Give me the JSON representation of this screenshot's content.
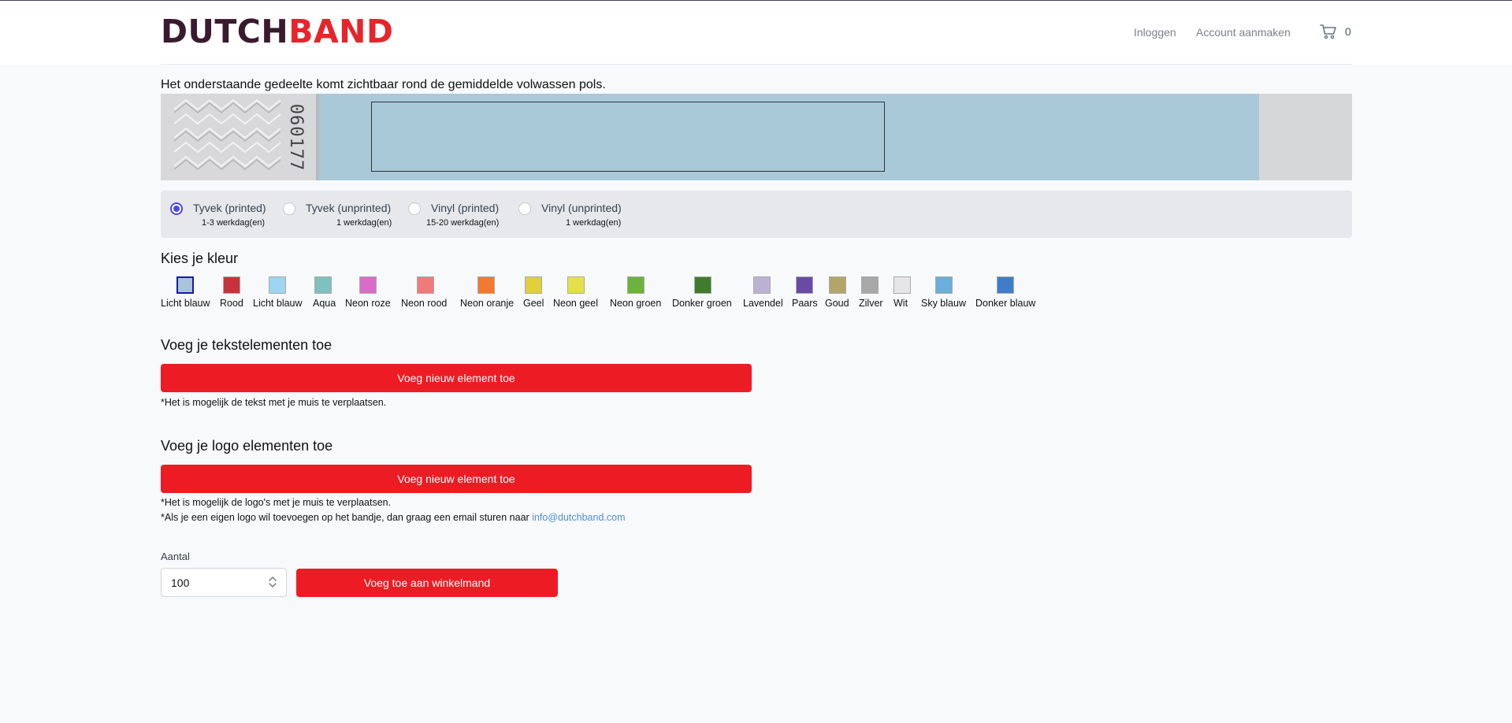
{
  "header": {
    "logo_part1": "DUTCH",
    "logo_part2": "BAND",
    "nav_login": "Inloggen",
    "nav_account": "Account aanmaken",
    "cart_count": "0",
    "cart_icon": "shopping-cart-icon"
  },
  "intro_text": "Het onderstaande gedeelte komt zichtbaar rond de gemiddelde volwassen pols.",
  "wristband": {
    "serial": "060177",
    "color": "#a9c9d8"
  },
  "material_options": [
    {
      "label": "Tyvek (printed)",
      "delivery": "1-3 werkdag(en)",
      "checked": true
    },
    {
      "label": "Tyvek (unprinted)",
      "delivery": "1 werkdag(en)",
      "checked": false
    },
    {
      "label": "Vinyl (printed)",
      "delivery": "15-20 werkdag(en)",
      "checked": false
    },
    {
      "label": "Vinyl (unprinted)",
      "delivery": "1 werkdag(en)",
      "checked": false
    }
  ],
  "color_section": {
    "title": "Kies je kleur",
    "colors": [
      {
        "name": "Licht blauw",
        "hex": "#a9c4d9",
        "selected": true
      },
      {
        "name": "Rood",
        "hex": "#c8323a",
        "selected": false
      },
      {
        "name": "Licht blauw",
        "hex": "#9fd4f2",
        "selected": false
      },
      {
        "name": "Aqua",
        "hex": "#7fc0c0",
        "selected": false
      },
      {
        "name": "Neon roze",
        "hex": "#d96cc9",
        "selected": false
      },
      {
        "name": "Neon rood",
        "hex": "#ef7b79",
        "selected": false
      },
      {
        "name": "Neon oranje",
        "hex": "#f07a30",
        "selected": false
      },
      {
        "name": "Geel",
        "hex": "#e1cf3e",
        "selected": false
      },
      {
        "name": "Neon geel",
        "hex": "#e4e04d",
        "selected": false
      },
      {
        "name": "Neon groen",
        "hex": "#6bb23f",
        "selected": false
      },
      {
        "name": "Donker groen",
        "hex": "#3f7d2c",
        "selected": false
      },
      {
        "name": "Lavendel",
        "hex": "#bbb2d3",
        "selected": false
      },
      {
        "name": "Paars",
        "hex": "#6a4ba4",
        "selected": false
      },
      {
        "name": "Goud",
        "hex": "#b3a46a",
        "selected": false
      },
      {
        "name": "Zilver",
        "hex": "#a8a8a8",
        "selected": false
      },
      {
        "name": "Wit",
        "hex": "#e6e6e8",
        "selected": false
      },
      {
        "name": "Sky blauw",
        "hex": "#6aaed9",
        "selected": false
      },
      {
        "name": "Donker blauw",
        "hex": "#3f7dc8",
        "selected": false
      }
    ]
  },
  "text_section": {
    "title": "Voeg je tekstelementen toe",
    "button": "Voeg nieuw element toe",
    "note": "*Het is mogelijk de tekst met je muis te verplaatsen."
  },
  "logo_section": {
    "title": "Voeg je logo elementen toe",
    "button": "Voeg nieuw element toe",
    "note1": "*Het is mogelijk de logo's met je muis te verplaatsen.",
    "note2_prefix": "*Als je een eigen logo wil toevoegen op het bandje, dan graag een email sturen naar",
    "email": "info@dutchband.com"
  },
  "order": {
    "quantity_label": "Aantal",
    "quantity_value": "100",
    "add_to_cart": "Voeg toe aan winkelmand"
  },
  "colors": {
    "brand_dark": "#3a1a2e",
    "brand_red": "#e8242b",
    "button_red": "#ed1c24",
    "radio_accent": "#4f46e5"
  }
}
